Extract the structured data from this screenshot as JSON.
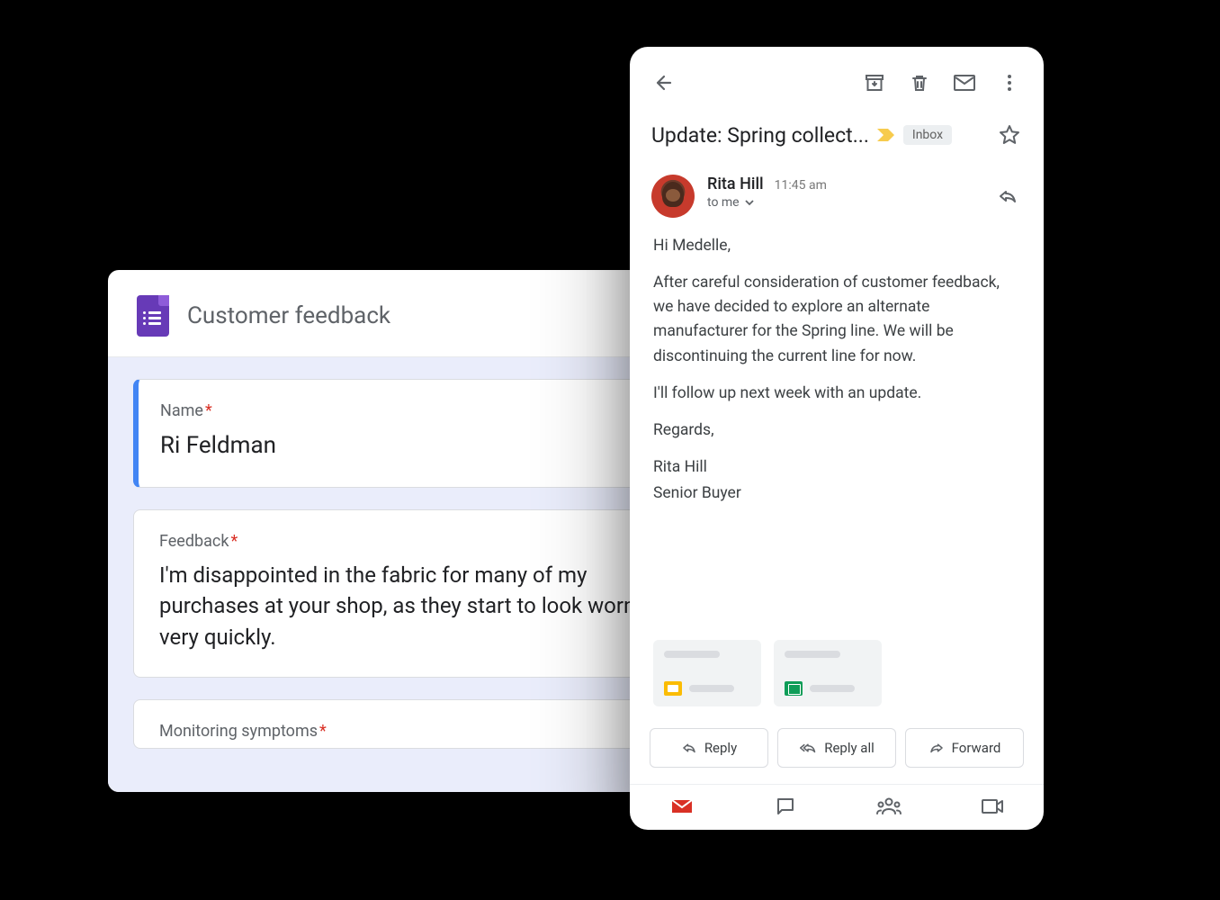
{
  "forms": {
    "title": "Customer feedback",
    "questions": [
      {
        "label": "Name",
        "required": true,
        "value": "Ri Feldman"
      },
      {
        "label": "Feedback",
        "required": true,
        "value": "I'm disappointed in the fabric for many of my purchases at your shop, as they start to look worn very quickly."
      },
      {
        "label": "Monitoring symptoms",
        "required": true,
        "value": ""
      }
    ]
  },
  "gmail": {
    "subject": "Update: Spring collect...",
    "inbox_chip": "Inbox",
    "sender": {
      "name": "Rita Hill",
      "time": "11:45 am",
      "to": "to me"
    },
    "body": {
      "greeting": "Hi Medelle,",
      "p1": "After careful consideration of customer feedback, we have decided to explore an alternate manufacturer for the Spring line. We will be discontinuing the current line for now.",
      "p2": "I'll follow up next week with an update.",
      "closing": "Regards,",
      "sig1": "Rita Hill",
      "sig2": "Senior Buyer"
    },
    "actions": {
      "reply": "Reply",
      "reply_all": "Reply all",
      "forward": "Forward"
    }
  }
}
